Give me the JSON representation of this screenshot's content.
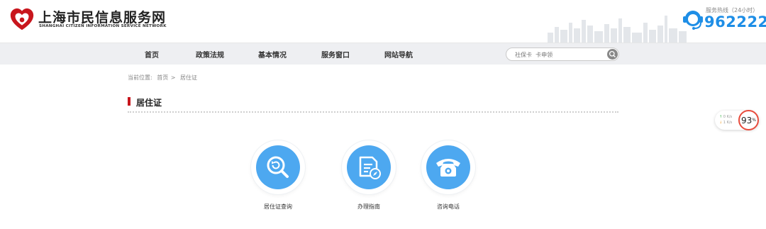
{
  "header": {
    "title": "上海市民信息服务网",
    "subtitle": "SHANGHAI CITIZEN INFORMATION SERVICE NETWORK",
    "hotline_label": "服务热线（24小时）",
    "hotline_number": "962222"
  },
  "nav": {
    "items": [
      "首页",
      "政策法规",
      "基本情况",
      "服务窗口",
      "网站导航"
    ],
    "search_placeholder": "社保卡  卡申领"
  },
  "breadcrumb": {
    "prefix": "当前位置:",
    "home": "首页",
    "separator": ">",
    "current": "居住证"
  },
  "page_title": "居住证",
  "services": [
    {
      "label": "居住证查询",
      "icon": "magnifier-refresh-icon"
    },
    {
      "label": "办理指南",
      "icon": "document-compass-icon"
    },
    {
      "label": "咨询电话",
      "icon": "telephone-icon"
    }
  ],
  "speed_widget": {
    "up": "0",
    "down": "1",
    "unit": "K/s",
    "percent": "93",
    "percent_unit": "%"
  },
  "colors": {
    "brand_red": "#c8161d",
    "hotline_blue": "#1e8ee6",
    "service_blue": "#4da8f0",
    "nav_bg": "#eeeff2"
  }
}
